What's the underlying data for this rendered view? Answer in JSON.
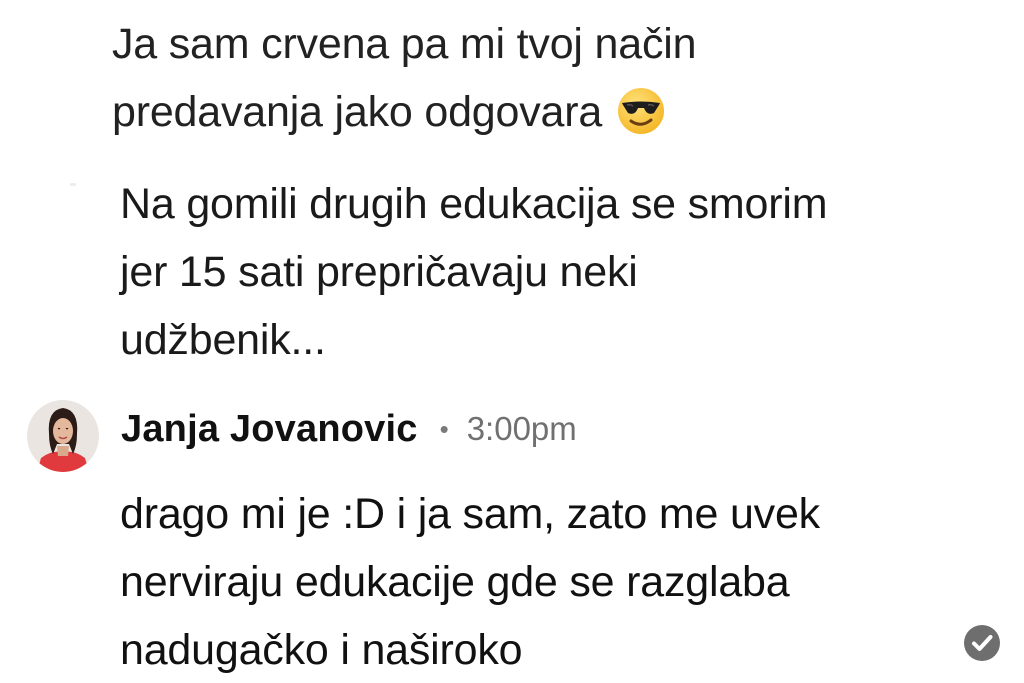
{
  "messages": [
    {
      "lines": [
        "Ja sam crvena pa mi tvoj način",
        "predavanja jako odgovara"
      ],
      "emoji": "smiling-face-with-sunglasses"
    },
    {
      "lines": [
        "Na gomili drugih edukacija se smorim",
        "jer 15 sati prepričavaju neki",
        "udžbenik..."
      ]
    }
  ],
  "reply": {
    "author": "Janja Jovanovic",
    "separator": "•",
    "time": "3:00pm",
    "lines": [
      "drago mi je :D i ja sam, zato me uvek",
      "nerviraju edukacije gde se razglaba",
      "nadugačko i naširoko"
    ],
    "status_icon": "read-check-icon"
  },
  "colors": {
    "text": "#1c1c1e",
    "timestamp": "#707070",
    "avatar_background": "#e8e2de",
    "avatar_outfit": "#e03a3e",
    "check_circle": "#6e6e6e"
  }
}
